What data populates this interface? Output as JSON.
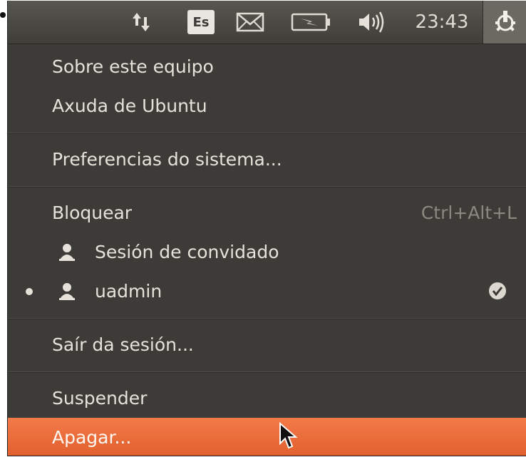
{
  "topbar": {
    "keyboard_layout": "Es",
    "clock": "23:43",
    "icons": [
      "network-icon",
      "keyboard-layout-indicator",
      "mail-icon",
      "battery-icon",
      "volume-icon",
      "session-icon"
    ]
  },
  "menu": {
    "items": [
      {
        "label": "Sobre este equipo"
      },
      {
        "label": "Axuda de Ubuntu"
      },
      {
        "label": "Preferencias do sistema..."
      },
      {
        "label": "Bloquear",
        "accelerator": "Ctrl+Alt+L"
      },
      {
        "label": "Sesión de convidado"
      },
      {
        "label": "uadmin",
        "active": true
      },
      {
        "label": "Saír da sesión..."
      },
      {
        "label": "Suspender"
      },
      {
        "label": "Apagar...",
        "highlighted": true
      }
    ]
  },
  "colors": {
    "menu_bg": "#3c3b37",
    "highlight": "#e9693a",
    "text": "#e6e2da"
  }
}
